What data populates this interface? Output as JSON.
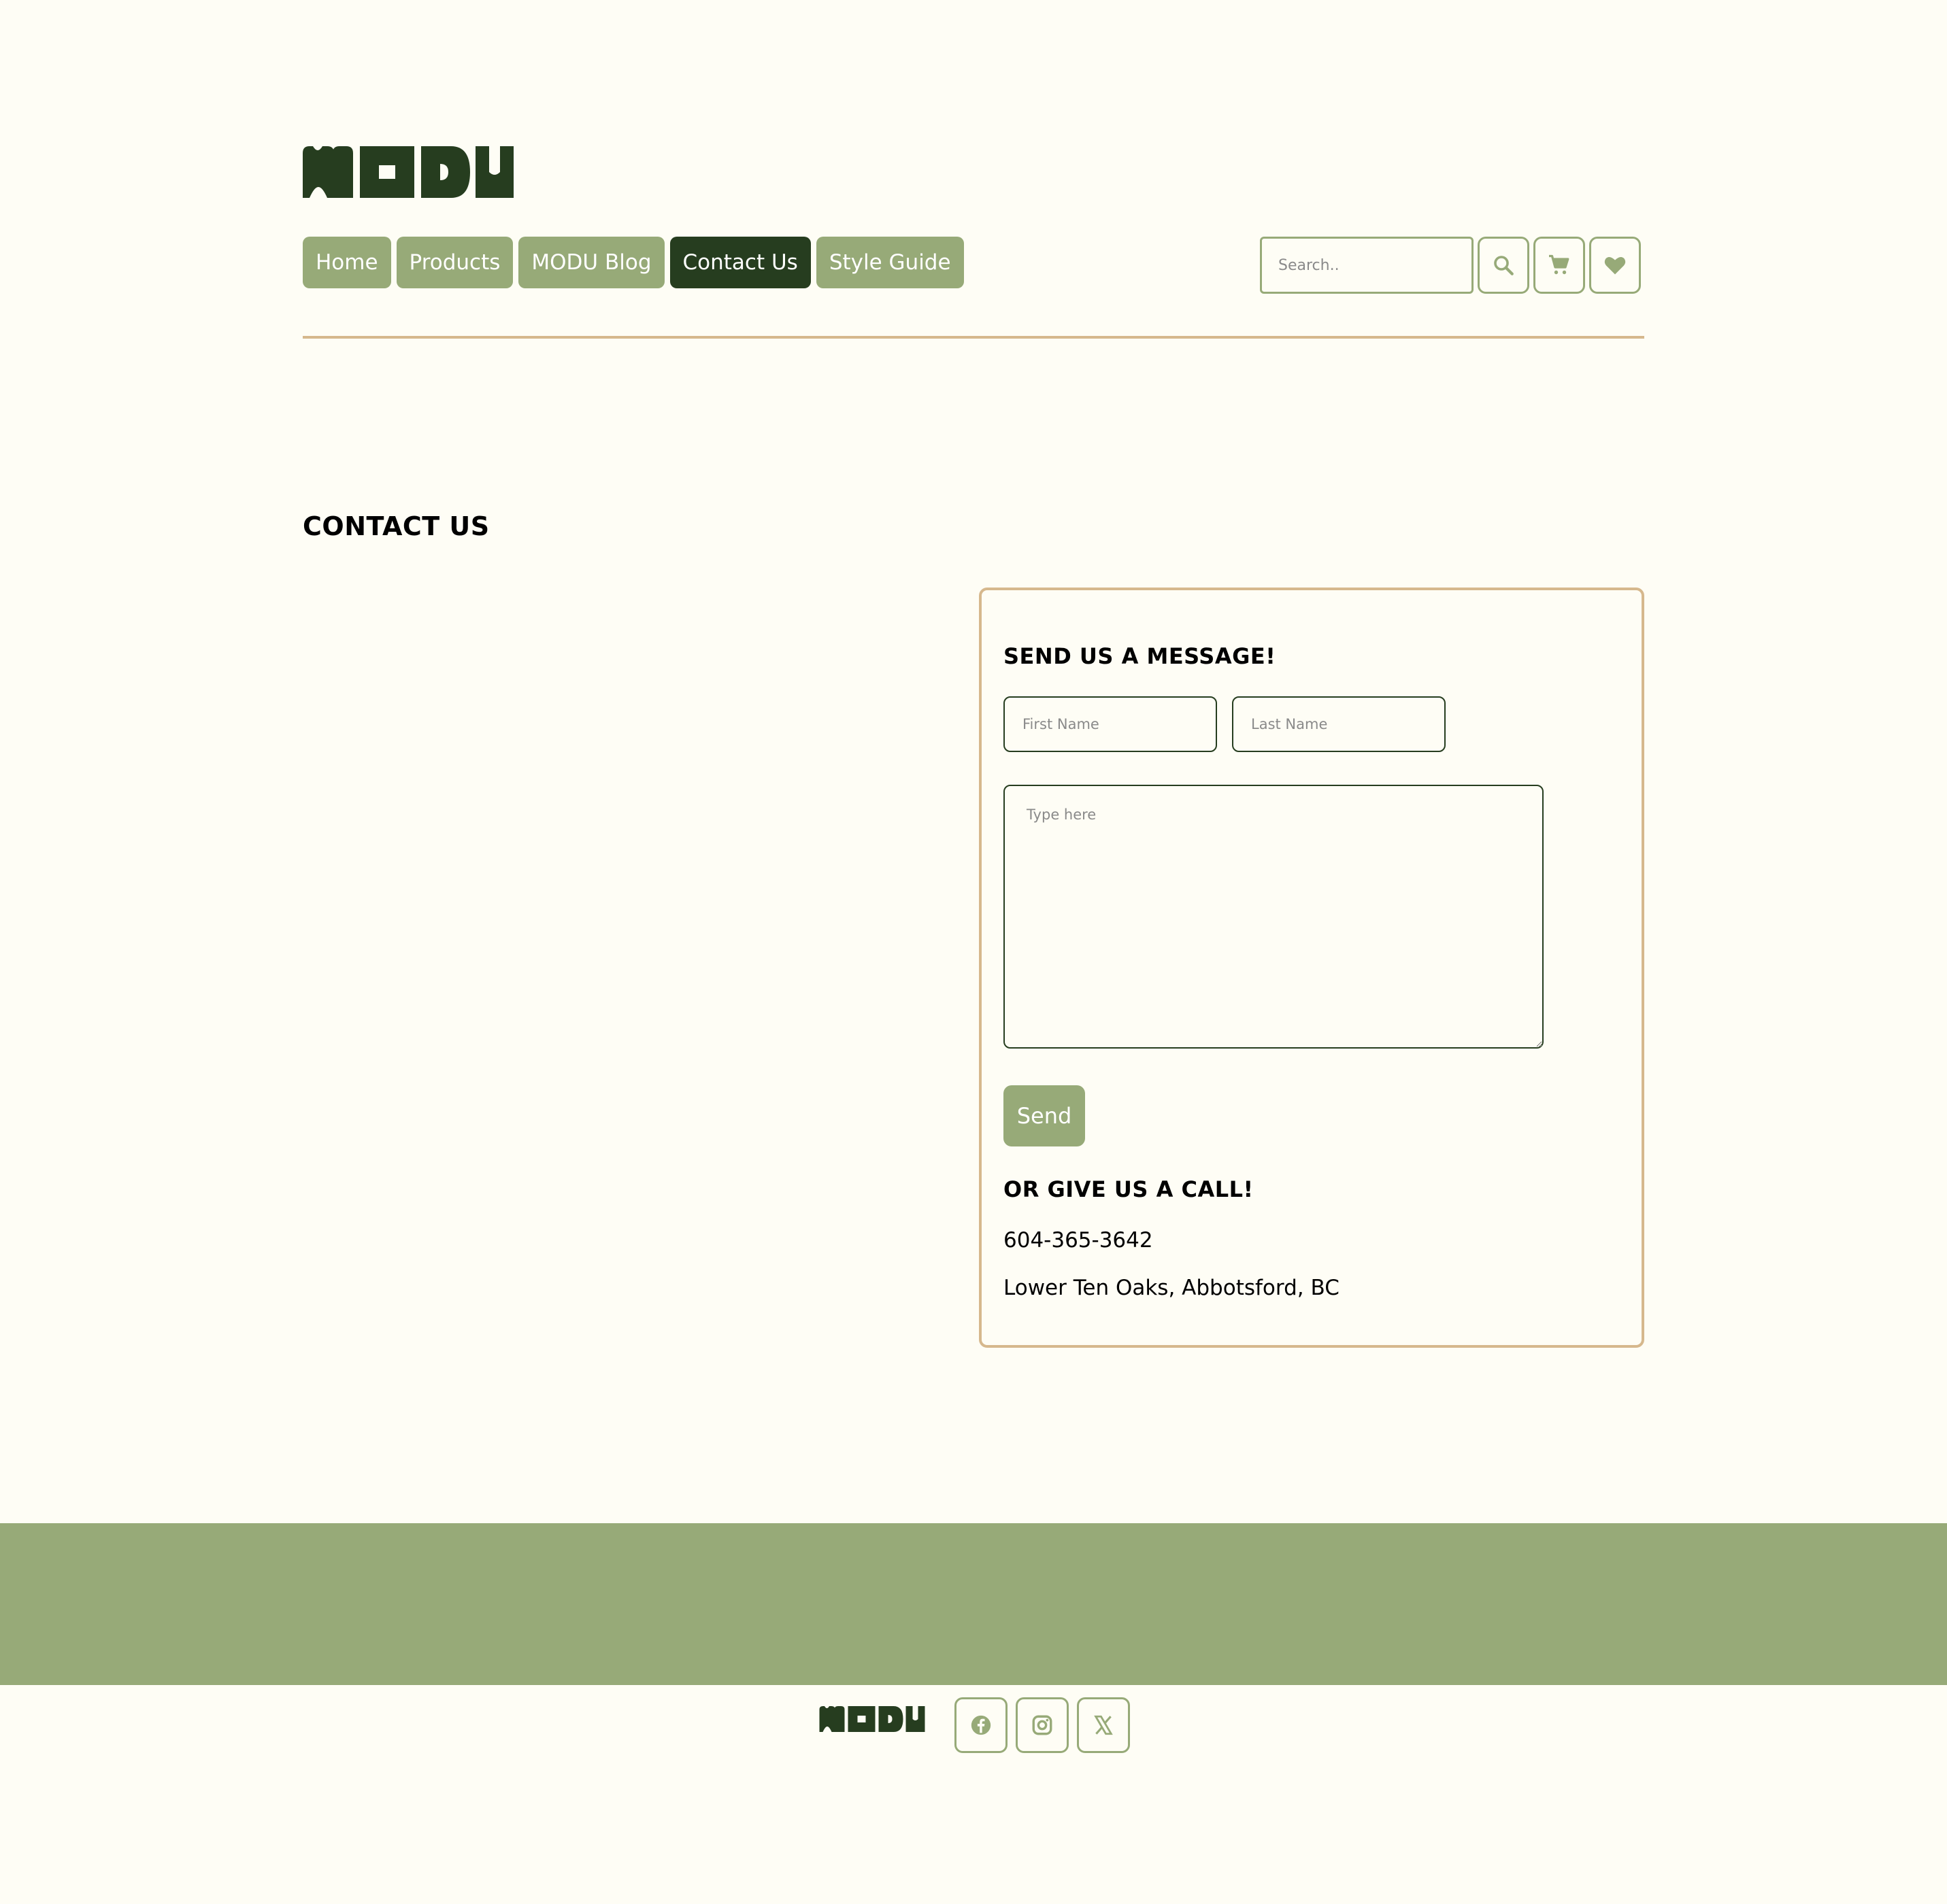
{
  "brand": {
    "name": "MODU",
    "color": "#263d1f"
  },
  "nav": {
    "items": [
      {
        "label": "Home"
      },
      {
        "label": "Products"
      },
      {
        "label": "MODU Blog"
      },
      {
        "label": "Contact Us",
        "active": true
      },
      {
        "label": "Style Guide"
      }
    ]
  },
  "header_actions": {
    "search_placeholder": "Search..",
    "search_icon": "search-icon",
    "cart_icon": "cart-icon",
    "wishlist_icon": "heart-icon"
  },
  "page": {
    "title": "CONTACT US"
  },
  "contact_form": {
    "heading": "SEND US A MESSAGE!",
    "first_name_placeholder": "First Name",
    "last_name_placeholder": "Last Name",
    "message_placeholder": "Type here",
    "first_name_value": "",
    "last_name_value": "",
    "message_value": "",
    "send_label": "Send"
  },
  "call_info": {
    "heading": "OR GIVE US A CALL!",
    "phone": "604-365-3642",
    "address": "Lower Ten Oaks, Abbotsford, BC"
  },
  "footer": {
    "social_icons": [
      "facebook-icon",
      "instagram-icon",
      "x-icon"
    ]
  },
  "colors": {
    "background": "#fefdf5",
    "accent": "#97aa78",
    "dark_green": "#263d1f",
    "border_tan": "#d6b88d"
  }
}
